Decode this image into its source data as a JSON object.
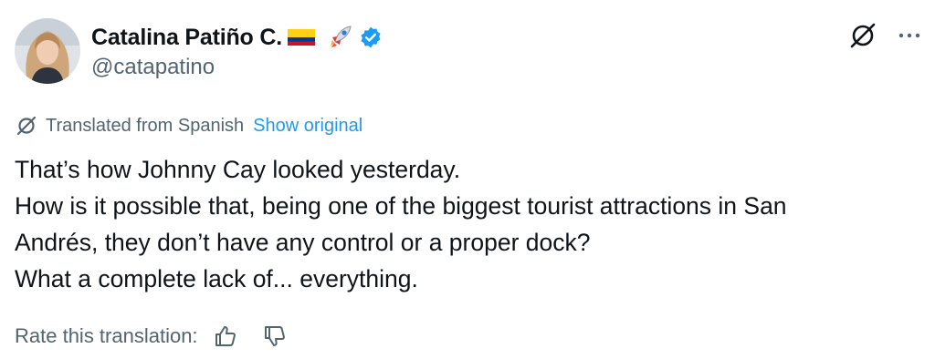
{
  "author": {
    "display_name": "Catalina Patiño C.",
    "handle": "@catapatino",
    "verified": true,
    "flag_icon": "colombia-flag-icon",
    "emoji_icon": "rocket-icon"
  },
  "translation": {
    "notice": "Translated from Spanish",
    "show_original": "Show original"
  },
  "tweet": {
    "lines": [
      "That’s how Johnny Cay looked yesterday.",
      "How is it possible that, being one of the biggest tourist attractions in San",
      "Andrés, they don’t have any control or a proper dock?",
      "What a complete lack of... everything."
    ]
  },
  "rating": {
    "label": "Rate this translation:"
  },
  "colors": {
    "accent": "#1d9bf0",
    "text": "#0f1419",
    "secondary": "#536471"
  }
}
